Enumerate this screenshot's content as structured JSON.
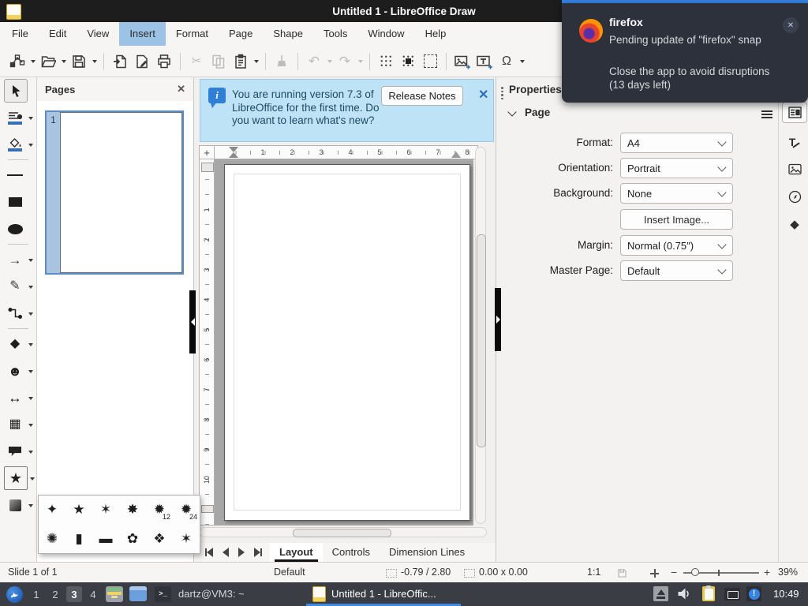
{
  "titlebar": {
    "title": "Untitled 1 - LibreOffice Draw"
  },
  "menubar": {
    "items": [
      "File",
      "Edit",
      "View",
      "Insert",
      "Format",
      "Page",
      "Shape",
      "Tools",
      "Window",
      "Help"
    ],
    "active_item": "Insert"
  },
  "notification": {
    "app_name": "firefox",
    "message": "Pending update of \"firefox\" snap",
    "detail": "Close the app to avoid disruptions (13 days left)"
  },
  "infobar": {
    "message": "You are running version 7.3 of LibreOffice for the first time. Do you want to learn what's new?",
    "release_notes_label": "Release Notes"
  },
  "pages_panel": {
    "title": "Pages",
    "page_number": "1"
  },
  "rulers": {
    "h": [
      "1",
      "2",
      "3",
      "4",
      "5",
      "6",
      "7",
      "8"
    ],
    "v": [
      "1",
      "2",
      "3",
      "4",
      "5",
      "6",
      "7",
      "8",
      "9",
      "10"
    ],
    "origin": "+"
  },
  "sidebar": {
    "deck_title": "Properties",
    "section_title": "Page",
    "fields": [
      {
        "label": "Format:",
        "value": "A4"
      },
      {
        "label": "Orientation:",
        "value": "Portrait"
      },
      {
        "label": "Background:",
        "value": "None"
      },
      {
        "label": "Margin:",
        "value": "Normal (0.75″)"
      },
      {
        "label": "Master Page:",
        "value": "Default"
      }
    ],
    "insert_image_label": "Insert Image..."
  },
  "tabbar": {
    "tabs": [
      "Layout",
      "Controls",
      "Dimension Lines"
    ],
    "active_tab": "Layout"
  },
  "statusbar": {
    "slide_info": "Slide 1 of 1",
    "style_name": "Default",
    "cursor_position": "-0.79 / 2.80",
    "object_size": "0.00 x 0.00",
    "scale": "1:1",
    "zoom_percent": "39%"
  },
  "taskbar": {
    "workspaces": [
      "1",
      "2",
      "3",
      "4"
    ],
    "active_workspace": "3",
    "terminal_label": "dartz@VM3: ~",
    "window_label": "Untitled 1 - LibreOffic...",
    "clock": "10:49"
  },
  "star_popup": {
    "row1": [
      "✦",
      "★",
      "✶",
      "✸",
      "✹",
      "✹"
    ],
    "row1_badges": [
      "",
      "",
      "",
      "",
      "12",
      "24"
    ],
    "row2": [
      "✺",
      "▮",
      "▬",
      "✿",
      "❖",
      "✶"
    ]
  },
  "glyphs": {
    "close": "✕",
    "omega": "Ω",
    "cut": "✂",
    "undo": "↶",
    "redo": "↷",
    "arrow_right": "→",
    "pencil": "✎",
    "diamond": "◆",
    "smiley": "☻",
    "double_arrow": "↔",
    "flowchart": "▦",
    "star": "★",
    "zoom_minus": "−",
    "zoom_plus": "+",
    "terminal_prompt": ">_",
    "exclaim": "!",
    "styles_letter": "T"
  },
  "colors": {
    "accent": "#3584e4",
    "menu_highlight": "#9cc3e5",
    "infobar_bg": "#bfe3f6"
  }
}
